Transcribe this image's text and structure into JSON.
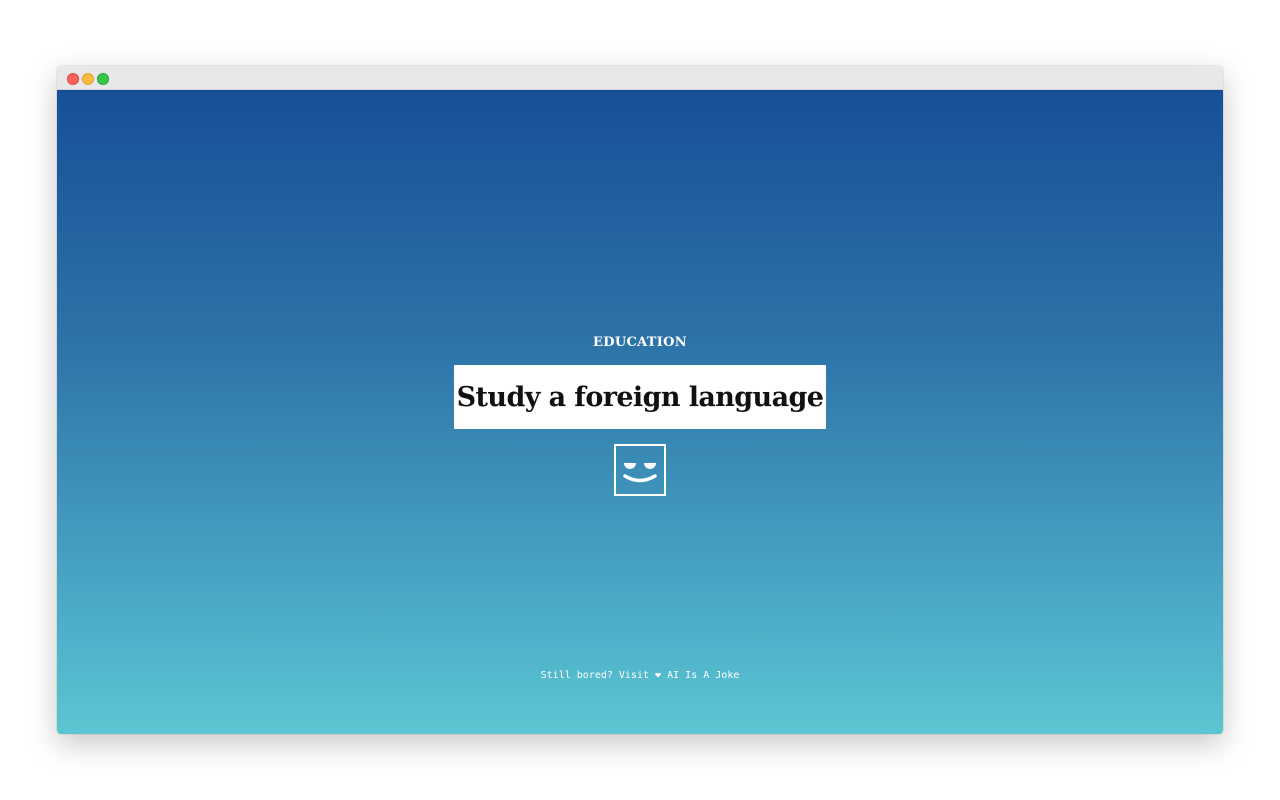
{
  "activity": {
    "category": "EDUCATION",
    "title": "Study a foreign language"
  },
  "icon": {
    "name": "smiling-face-icon"
  },
  "footer": {
    "prefix": "Still bored? Visit",
    "heart": "❤",
    "link_label": "AI Is A Joke"
  },
  "colors": {
    "gradient_top": "#174f97",
    "gradient_bottom": "#5bc6d2",
    "title_box": "#ffffff",
    "title_text": "#111111"
  }
}
